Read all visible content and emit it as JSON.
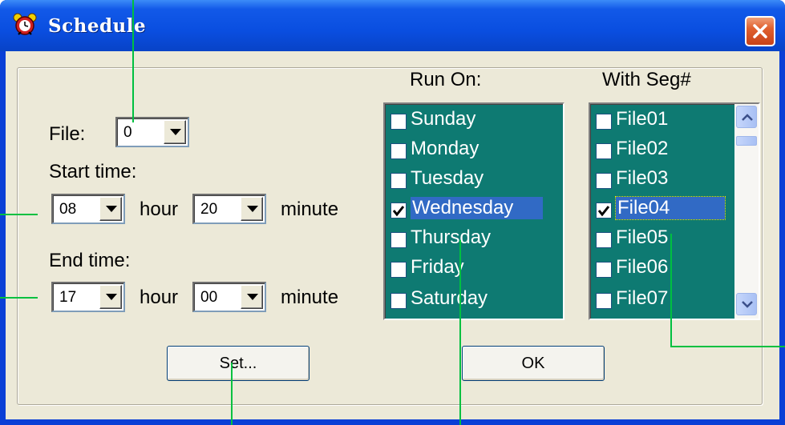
{
  "window": {
    "title": "Schedule",
    "icon": "alarm-clock-icon",
    "close_icon": "close-icon"
  },
  "file": {
    "label": "File:",
    "value": "0"
  },
  "start_time": {
    "label": "Start time:",
    "hour_value": "08",
    "hour_unit": "hour",
    "minute_value": "20",
    "minute_unit": "minute"
  },
  "end_time": {
    "label": "End time:",
    "hour_value": "17",
    "hour_unit": "hour",
    "minute_value": "00",
    "minute_unit": "minute"
  },
  "run_on": {
    "header": "Run On:",
    "items": [
      {
        "label": "Sunday",
        "checked": false
      },
      {
        "label": "Monday",
        "checked": false
      },
      {
        "label": "Tuesday",
        "checked": false
      },
      {
        "label": "Wednesday",
        "checked": true,
        "selected": true
      },
      {
        "label": "Thursday",
        "checked": false
      },
      {
        "label": "Friday",
        "checked": false
      },
      {
        "label": "Saturday",
        "checked": false
      }
    ]
  },
  "with_seg": {
    "header": "With Seg#",
    "items": [
      {
        "label": "File01",
        "checked": false
      },
      {
        "label": "File02",
        "checked": false
      },
      {
        "label": "File03",
        "checked": false
      },
      {
        "label": "File04",
        "checked": true,
        "selected": true
      },
      {
        "label": "File05",
        "checked": false
      },
      {
        "label": "File06",
        "checked": false
      },
      {
        "label": "File07",
        "checked": false
      }
    ]
  },
  "buttons": {
    "set_label": "Set...",
    "ok_label": "OK"
  },
  "colors": {
    "list_background": "#0e7a72",
    "selection": "#316ac5",
    "callout_lines": "#00c040",
    "title_bar": "#0a4ee0"
  }
}
